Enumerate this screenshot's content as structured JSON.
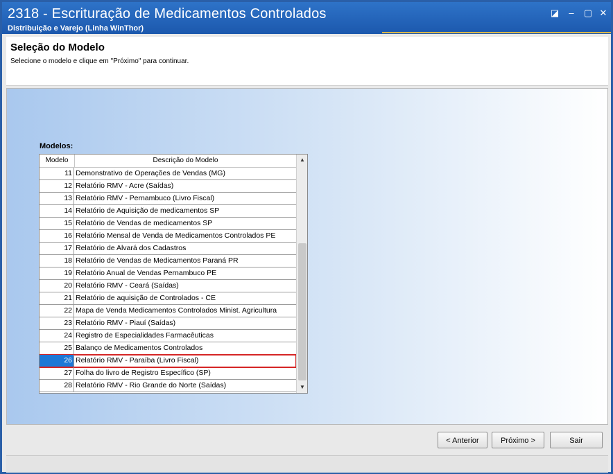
{
  "window": {
    "title": "2318 - Escrituração de Medicamentos Controlados",
    "subtitle": "Distribuição e Varejo (Linha WinThor)",
    "controls": {
      "restore_icon": "restore-icon",
      "minimize_icon": "minimize-icon",
      "maximize_icon": "maximize-icon",
      "close_icon": "close-icon"
    }
  },
  "header": {
    "title": "Seleção do Modelo",
    "description": "Selecione o modelo e clique em \"Próximo\" para continuar."
  },
  "models": {
    "label": "Modelos:",
    "columns": {
      "model": "Modelo",
      "description": "Descrição do Modelo"
    },
    "rows": [
      {
        "num": "11",
        "desc": "Demonstrativo de Operações de Vendas (MG)"
      },
      {
        "num": "12",
        "desc": "Relatório RMV - Acre (Saídas)"
      },
      {
        "num": "13",
        "desc": "Relatório RMV - Pernambuco (Livro Fiscal)"
      },
      {
        "num": "14",
        "desc": "Relatório de Aquisição de medicamentos SP"
      },
      {
        "num": "15",
        "desc": "Relatório de Vendas de medicamentos SP"
      },
      {
        "num": "16",
        "desc": "Relatório Mensal de Venda de Medicamentos Controlados PE"
      },
      {
        "num": "17",
        "desc": "Relatório de Alvará dos Cadastros"
      },
      {
        "num": "18",
        "desc": "Relatório de Vendas de Medicamentos Paraná PR"
      },
      {
        "num": "19",
        "desc": "Relatório Anual de Vendas Pernambuco PE"
      },
      {
        "num": "20",
        "desc": "Relatório RMV - Ceará (Saídas)"
      },
      {
        "num": "21",
        "desc": "Relatório de aquisição de Controlados - CE"
      },
      {
        "num": "22",
        "desc": "Mapa de Venda Medicamentos Controlados Minist. Agricultura"
      },
      {
        "num": "23",
        "desc": "Relatório RMV - Piauí (Saídas)"
      },
      {
        "num": "24",
        "desc": "Registro de Especialidades Farmacêuticas"
      },
      {
        "num": "25",
        "desc": "Balanço de Medicamentos Controlados"
      },
      {
        "num": "26",
        "desc": "Relatório RMV - Paraíba (Livro Fiscal)"
      },
      {
        "num": "27",
        "desc": "Folha do livro de Registro Específico (SP)"
      },
      {
        "num": "28",
        "desc": "Relatório RMV - Rio Grande do Norte (Saídas)"
      }
    ],
    "selected_model": "26"
  },
  "buttons": {
    "previous": "< Anterior",
    "next": "Próximo >",
    "exit": "Sair"
  },
  "colors": {
    "titlebar": "#1c58ad",
    "selection": "#1e78d6",
    "highlight_border": "#d52525"
  }
}
